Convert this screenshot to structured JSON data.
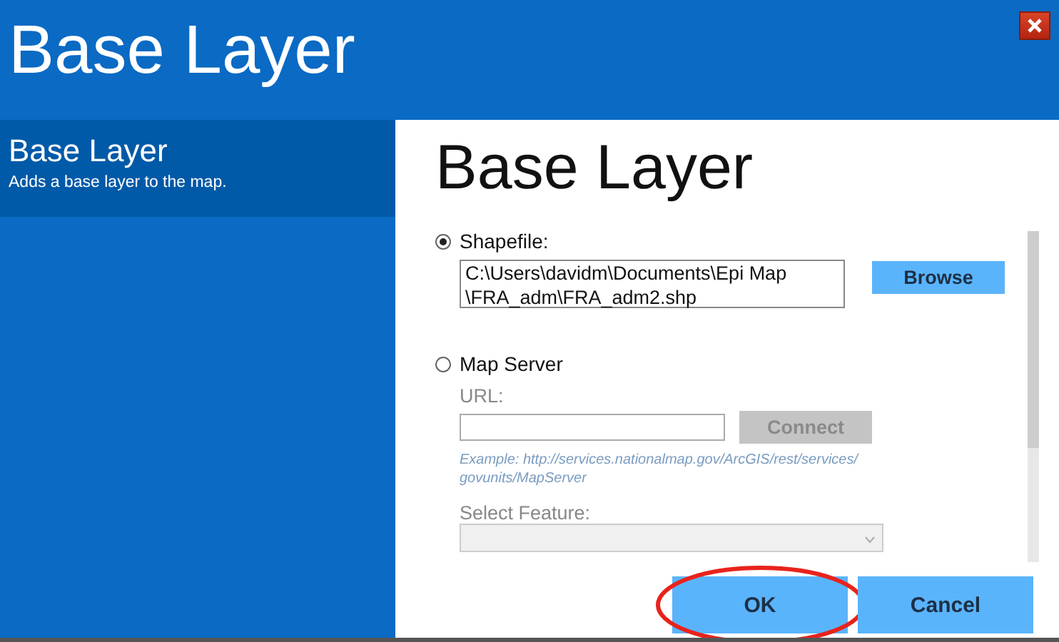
{
  "window": {
    "title": "Base Layer"
  },
  "sidebar": {
    "items": [
      {
        "title": "Base Layer",
        "description": "Adds a base layer to the map.",
        "selected": true
      }
    ]
  },
  "panel": {
    "heading": "Base Layer",
    "shapefile": {
      "label": "Shapefile:",
      "selected": true,
      "value_lines": [
        "C:\\Users\\davidm\\Documents\\Epi Map",
        "\\FRA_adm\\FRA_adm2.shp"
      ],
      "button": "Browse"
    },
    "map_server": {
      "label": "Map Server",
      "selected": false,
      "disabled": true,
      "url_label": "URL:",
      "button": "Connect",
      "example": "Example: http://services.nationalmap.gov/ArcGIS/rest/services/ govunits/MapServer",
      "feature_label": "Select Feature:"
    }
  },
  "buttons": [
    {
      "label": "OK",
      "highlighted": true
    },
    {
      "label": "Cancel",
      "highlighted": false
    }
  ]
}
